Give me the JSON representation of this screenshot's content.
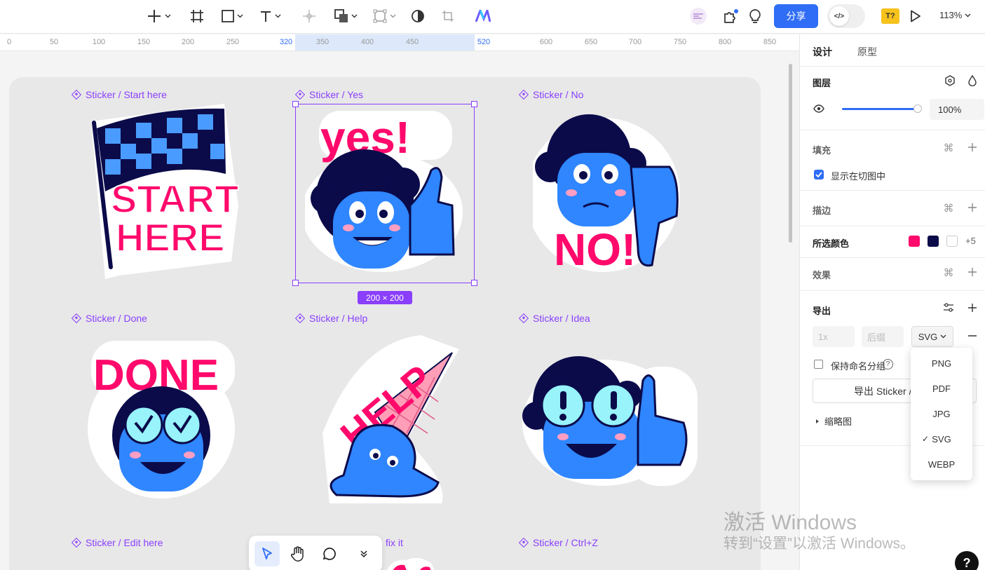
{
  "toolbar": {
    "share_label": "分享",
    "text_badge": "T?",
    "zoom": "113%",
    "dev_toggle_label": "</>"
  },
  "ruler": {
    "ticks": [
      "0",
      "50",
      "100",
      "150",
      "200",
      "250",
      "320",
      "350",
      "400",
      "450",
      "520",
      "600",
      "650",
      "700",
      "750",
      "800",
      "850"
    ],
    "highlight": [
      "320",
      "520"
    ]
  },
  "canvas": {
    "frames": [
      {
        "label": "Sticker / Start here"
      },
      {
        "label": "Sticker / Yes"
      },
      {
        "label": "Sticker / No"
      },
      {
        "label": "Sticker / Done"
      },
      {
        "label": "Sticker / Help"
      },
      {
        "label": "Sticker / Idea"
      },
      {
        "label": "Sticker / Edit here"
      },
      {
        "label": "fix it"
      },
      {
        "label": "Sticker / Ctrl+Z"
      }
    ],
    "stickers": {
      "start_line1": "START",
      "start_line2": "HERE",
      "yes": "yes!",
      "no": "NO!",
      "done": "DONE",
      "help": "HELP"
    },
    "selection_size": "200 × 200"
  },
  "panel": {
    "tabs": [
      "设计",
      "原型"
    ],
    "layer_title": "图层",
    "opacity": "100%",
    "fill_title": "填充",
    "show_in_slice": "显示在切图中",
    "stroke_title": "描边",
    "selected_colors_title": "所选颜色",
    "selected_colors": [
      "#ff0a6c",
      "#0b0b4a",
      "#ffffff"
    ],
    "more_colors": "+5",
    "effects_title": "效果",
    "export_title": "导出",
    "scale_placeholder": "1x",
    "suffix_placeholder": "后缀",
    "format": "SVG",
    "keep_group_label": "保持命名分组",
    "export_button": "导出 Sticker / Yes",
    "thumbnail_label": "缩略图"
  },
  "dropdown": {
    "options": [
      "PNG",
      "PDF",
      "JPG",
      "SVG",
      "WEBP"
    ],
    "selected": "SVG"
  },
  "watermark": {
    "line1": "激活 Windows",
    "line2": "转到“设置”以激活 Windows。"
  },
  "help_fab": "?"
}
